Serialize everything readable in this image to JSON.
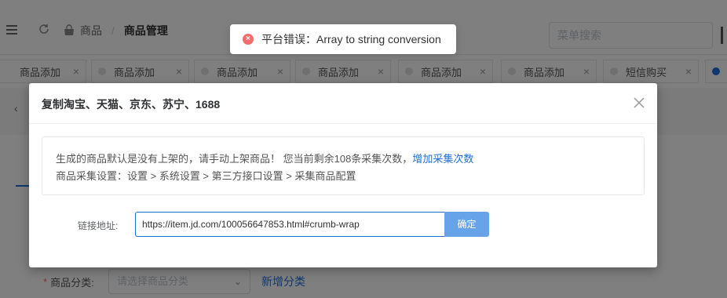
{
  "header": {
    "breadcrumb": {
      "home": "商品",
      "separator": "/",
      "current": "商品管理"
    },
    "search_placeholder": "菜单搜索"
  },
  "tabs": [
    {
      "label": "商品添加",
      "close": "×"
    },
    {
      "label": "商品添加",
      "close": "×"
    },
    {
      "label": "商品添加",
      "close": "×"
    },
    {
      "label": "商品添加",
      "close": "×"
    },
    {
      "label": "商品添加",
      "close": "×"
    },
    {
      "label": "商品添加",
      "close": "×"
    },
    {
      "label": "短信购买",
      "close": "×"
    }
  ],
  "form": {
    "category_label": "商品分类:",
    "category_required": "*",
    "category_placeholder": "请选择商品分类",
    "add_category": "新增分类"
  },
  "toast": {
    "message": "平台错误：Array to string conversion",
    "icon": "error-icon"
  },
  "dialog": {
    "title": "复制淘宝、天猫、京东、苏宁、1688",
    "info_line1": "生成的商品默认是没有上架的，请手动上架商品！ 您当前剩余108条采集次数，",
    "info_link": "增加采集次数",
    "info_line2": "商品采集设置：设置 > 系统设置 > 第三方接口设置 > 采集商品配置",
    "url_label": "链接地址:",
    "url_value": "https://item.jd.com/100056647853.html#crumb-wrap",
    "confirm_label": "确定"
  },
  "colors": {
    "primary": "#1e6fd9",
    "confirm_bg": "#66a3e8",
    "error": "#f56c6c",
    "mask": "rgba(0,0,0,0.5)"
  }
}
